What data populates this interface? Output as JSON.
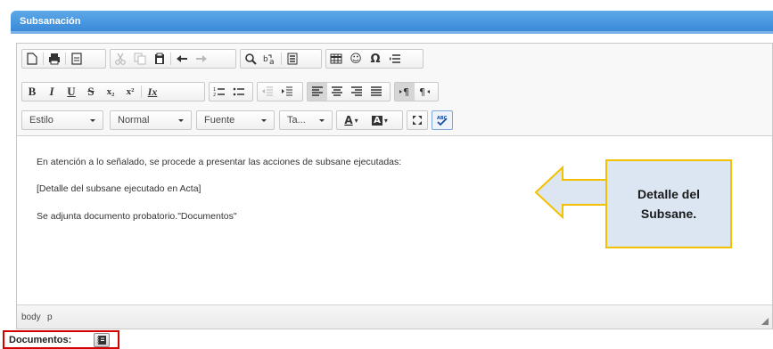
{
  "panel": {
    "title": "Subsanación"
  },
  "toolbar": {
    "row1": {
      "icons": [
        "new-page-icon",
        "print-icon",
        "templates-icon",
        "cut-icon",
        "copy-icon",
        "paste-icon",
        "undo-icon",
        "redo-icon",
        "find-icon",
        "replace-icon",
        "select-all-icon",
        "table-icon",
        "emoji-icon",
        "special-char-icon",
        "page-break-icon"
      ],
      "glyph_emoji": "☺",
      "glyph_omega": "Ω"
    },
    "row2": {
      "bold": "B",
      "italic": "I",
      "underline": "U",
      "strike": "S",
      "subscript": "x₂",
      "superscript": "x²",
      "remove_format": "Ix"
    },
    "row3": {
      "style": "Estilo",
      "format": "Normal",
      "font": "Fuente",
      "size": "Ta...",
      "text_color": "A",
      "bg_color": "A"
    }
  },
  "content": {
    "line1": "En atención a lo señalado, se procede a presentar las acciones de subsane ejecutadas:",
    "line2": "[Detalle del subsane ejecutado en Acta]",
    "line3": "Se adjunta documento probatorio.\"Documentos\""
  },
  "callout": {
    "line1": "Detalle del",
    "line2": "Subsane."
  },
  "status": {
    "path": [
      "body",
      "p"
    ]
  },
  "documents": {
    "label": "Documentos:"
  },
  "colors": {
    "header_blue": "#3a8ad8",
    "callout_fill": "#dce6f2",
    "callout_border": "#f2c200",
    "highlight_red": "#d40000"
  }
}
